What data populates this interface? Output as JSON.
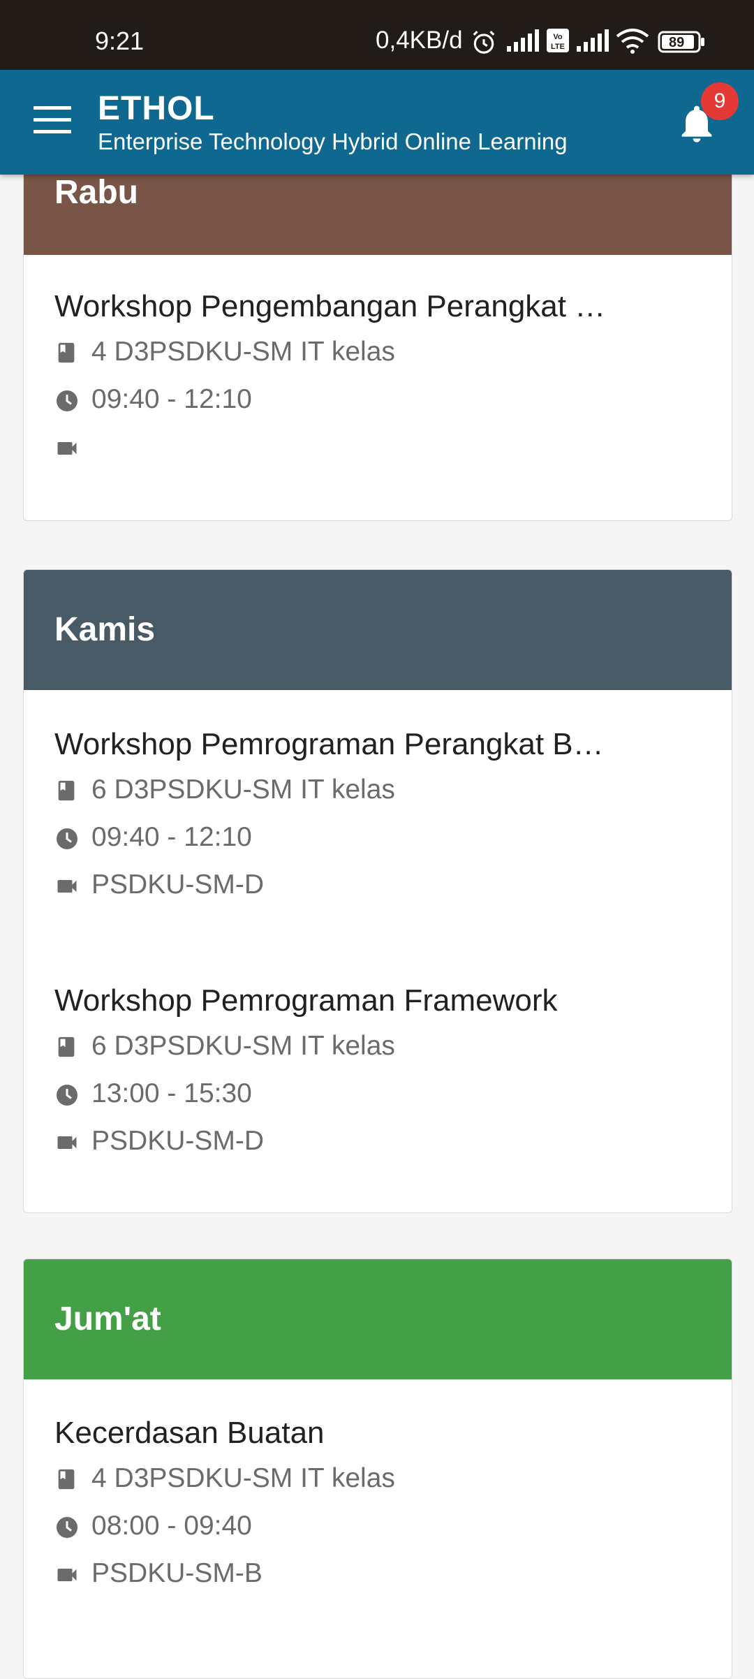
{
  "status_bar": {
    "time": "9:21",
    "network_speed": "0,4KB/d",
    "battery": "89",
    "icons": [
      "alarm-icon",
      "signal-icon",
      "volte-icon",
      "signal-icon",
      "wifi-icon",
      "battery-icon"
    ]
  },
  "app_bar": {
    "title": "ETHOL",
    "subtitle": "Enterprise Technology Hybrid Online Learning",
    "notification_count": "9",
    "color": "#0e6890"
  },
  "schedule": [
    {
      "day": "Rabu",
      "color": "#795548",
      "classes": [
        {
          "course": "Workshop Pengembangan Perangkat …",
          "class": "4 D3PSDKU-SM IT kelas",
          "time": "09:40 - 12:10",
          "room": ""
        }
      ]
    },
    {
      "day": "Kamis",
      "color": "#475a66",
      "classes": [
        {
          "course": "Workshop Pemrograman Perangkat B…",
          "class": "6 D3PSDKU-SM IT kelas",
          "time": "09:40 - 12:10",
          "room": "PSDKU-SM-D"
        },
        {
          "course": "Workshop Pemrograman Framework",
          "class": "6 D3PSDKU-SM IT kelas",
          "time": "13:00 - 15:30",
          "room": "PSDKU-SM-D"
        }
      ]
    },
    {
      "day": "Jum'at",
      "color": "#43a047",
      "classes": [
        {
          "course": "Kecerdasan Buatan",
          "class": "4 D3PSDKU-SM IT kelas",
          "time": "08:00 - 09:40",
          "room": "PSDKU-SM-B"
        }
      ]
    }
  ]
}
